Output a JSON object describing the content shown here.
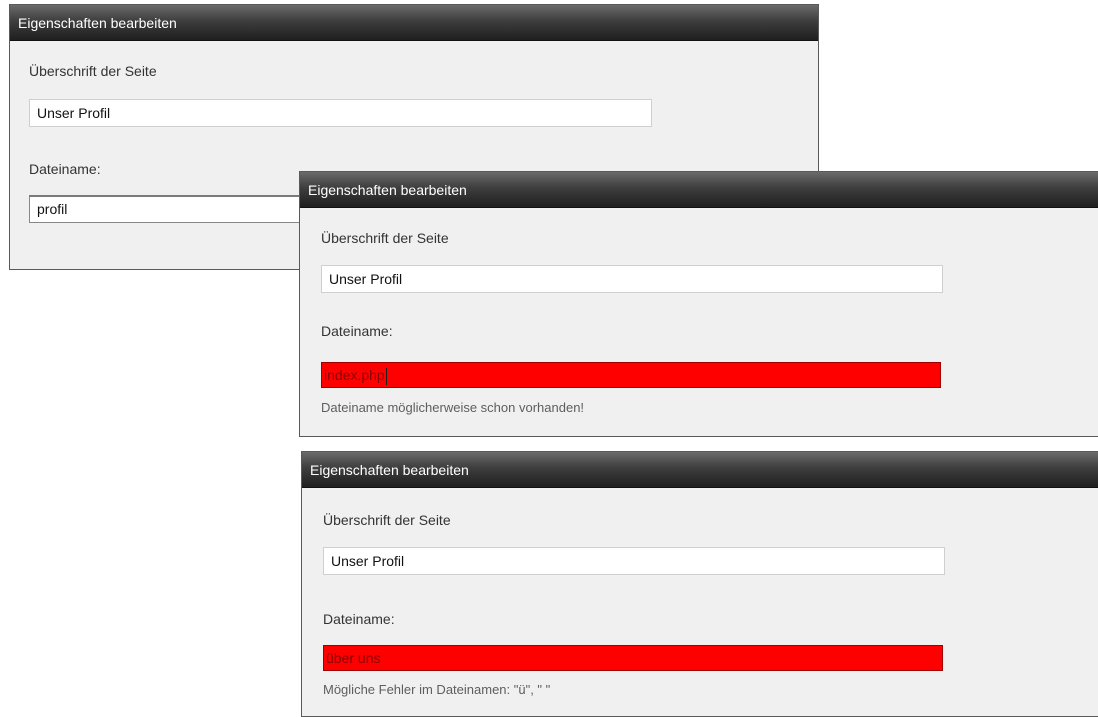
{
  "panels": [
    {
      "title": "Eigenschaften bearbeiten",
      "heading_label": "Überschrift der Seite",
      "heading_value": "Unser Profil",
      "filename_label": "Dateiname:",
      "filename_value": "profil",
      "error": ""
    },
    {
      "title": "Eigenschaften bearbeiten",
      "heading_label": "Überschrift der Seite",
      "heading_value": "Unser Profil",
      "filename_label": "Dateiname:",
      "filename_value": "index.php",
      "error": "Dateiname möglicherweise schon vorhanden!"
    },
    {
      "title": "Eigenschaften bearbeiten",
      "heading_label": "Überschrift der Seite",
      "heading_value": "Unser Profil",
      "filename_label": "Dateiname:",
      "filename_value": "über uns",
      "error": "Mögliche Fehler im Dateinamen: \"ü\", \" \""
    }
  ],
  "colors": {
    "panel_bg": "#f0f0f0",
    "header_dark": "#1f1f1f",
    "error_field": "#ff0000",
    "error_text": "#5e5e5e"
  }
}
